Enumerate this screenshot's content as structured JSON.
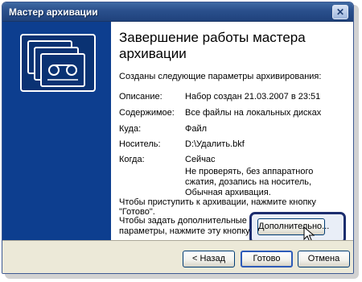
{
  "window": {
    "title": "Мастер архивации",
    "close_glyph": "✕"
  },
  "page": {
    "heading": "Завершение работы мастера архивации",
    "intro": "Созданы следующие параметры архивирования:",
    "details": [
      {
        "label": "Описание:",
        "value": "Набор создан 21.03.2007 в 23:51"
      },
      {
        "label": "Содержимое:",
        "value": "Все файлы на локальных дисках"
      },
      {
        "label": "Куда:",
        "value": "Файл"
      },
      {
        "label": "Носитель:",
        "value": "D:\\Удалить.bkf"
      },
      {
        "label": "Когда:",
        "value": "Сейчас"
      }
    ],
    "options_note": "Не проверять, без аппаратного сжатия, дозапись на носитель, Обычная архивация.",
    "start_hint": "Чтобы приступить к архивации, нажмите кнопку \"Готово\".",
    "advanced_hint": "Чтобы задать дополнительные параметры, нажмите эту кнопку.",
    "advanced_button": "Дополнительно..."
  },
  "footer": {
    "back_button": "< Назад",
    "finish_button": "Готово",
    "cancel_button": "Отмена"
  },
  "colors": {
    "titlebar": "#2a4f8c",
    "sidebar": "#0d3e8f",
    "highlight_border": "#1c2d6e"
  }
}
